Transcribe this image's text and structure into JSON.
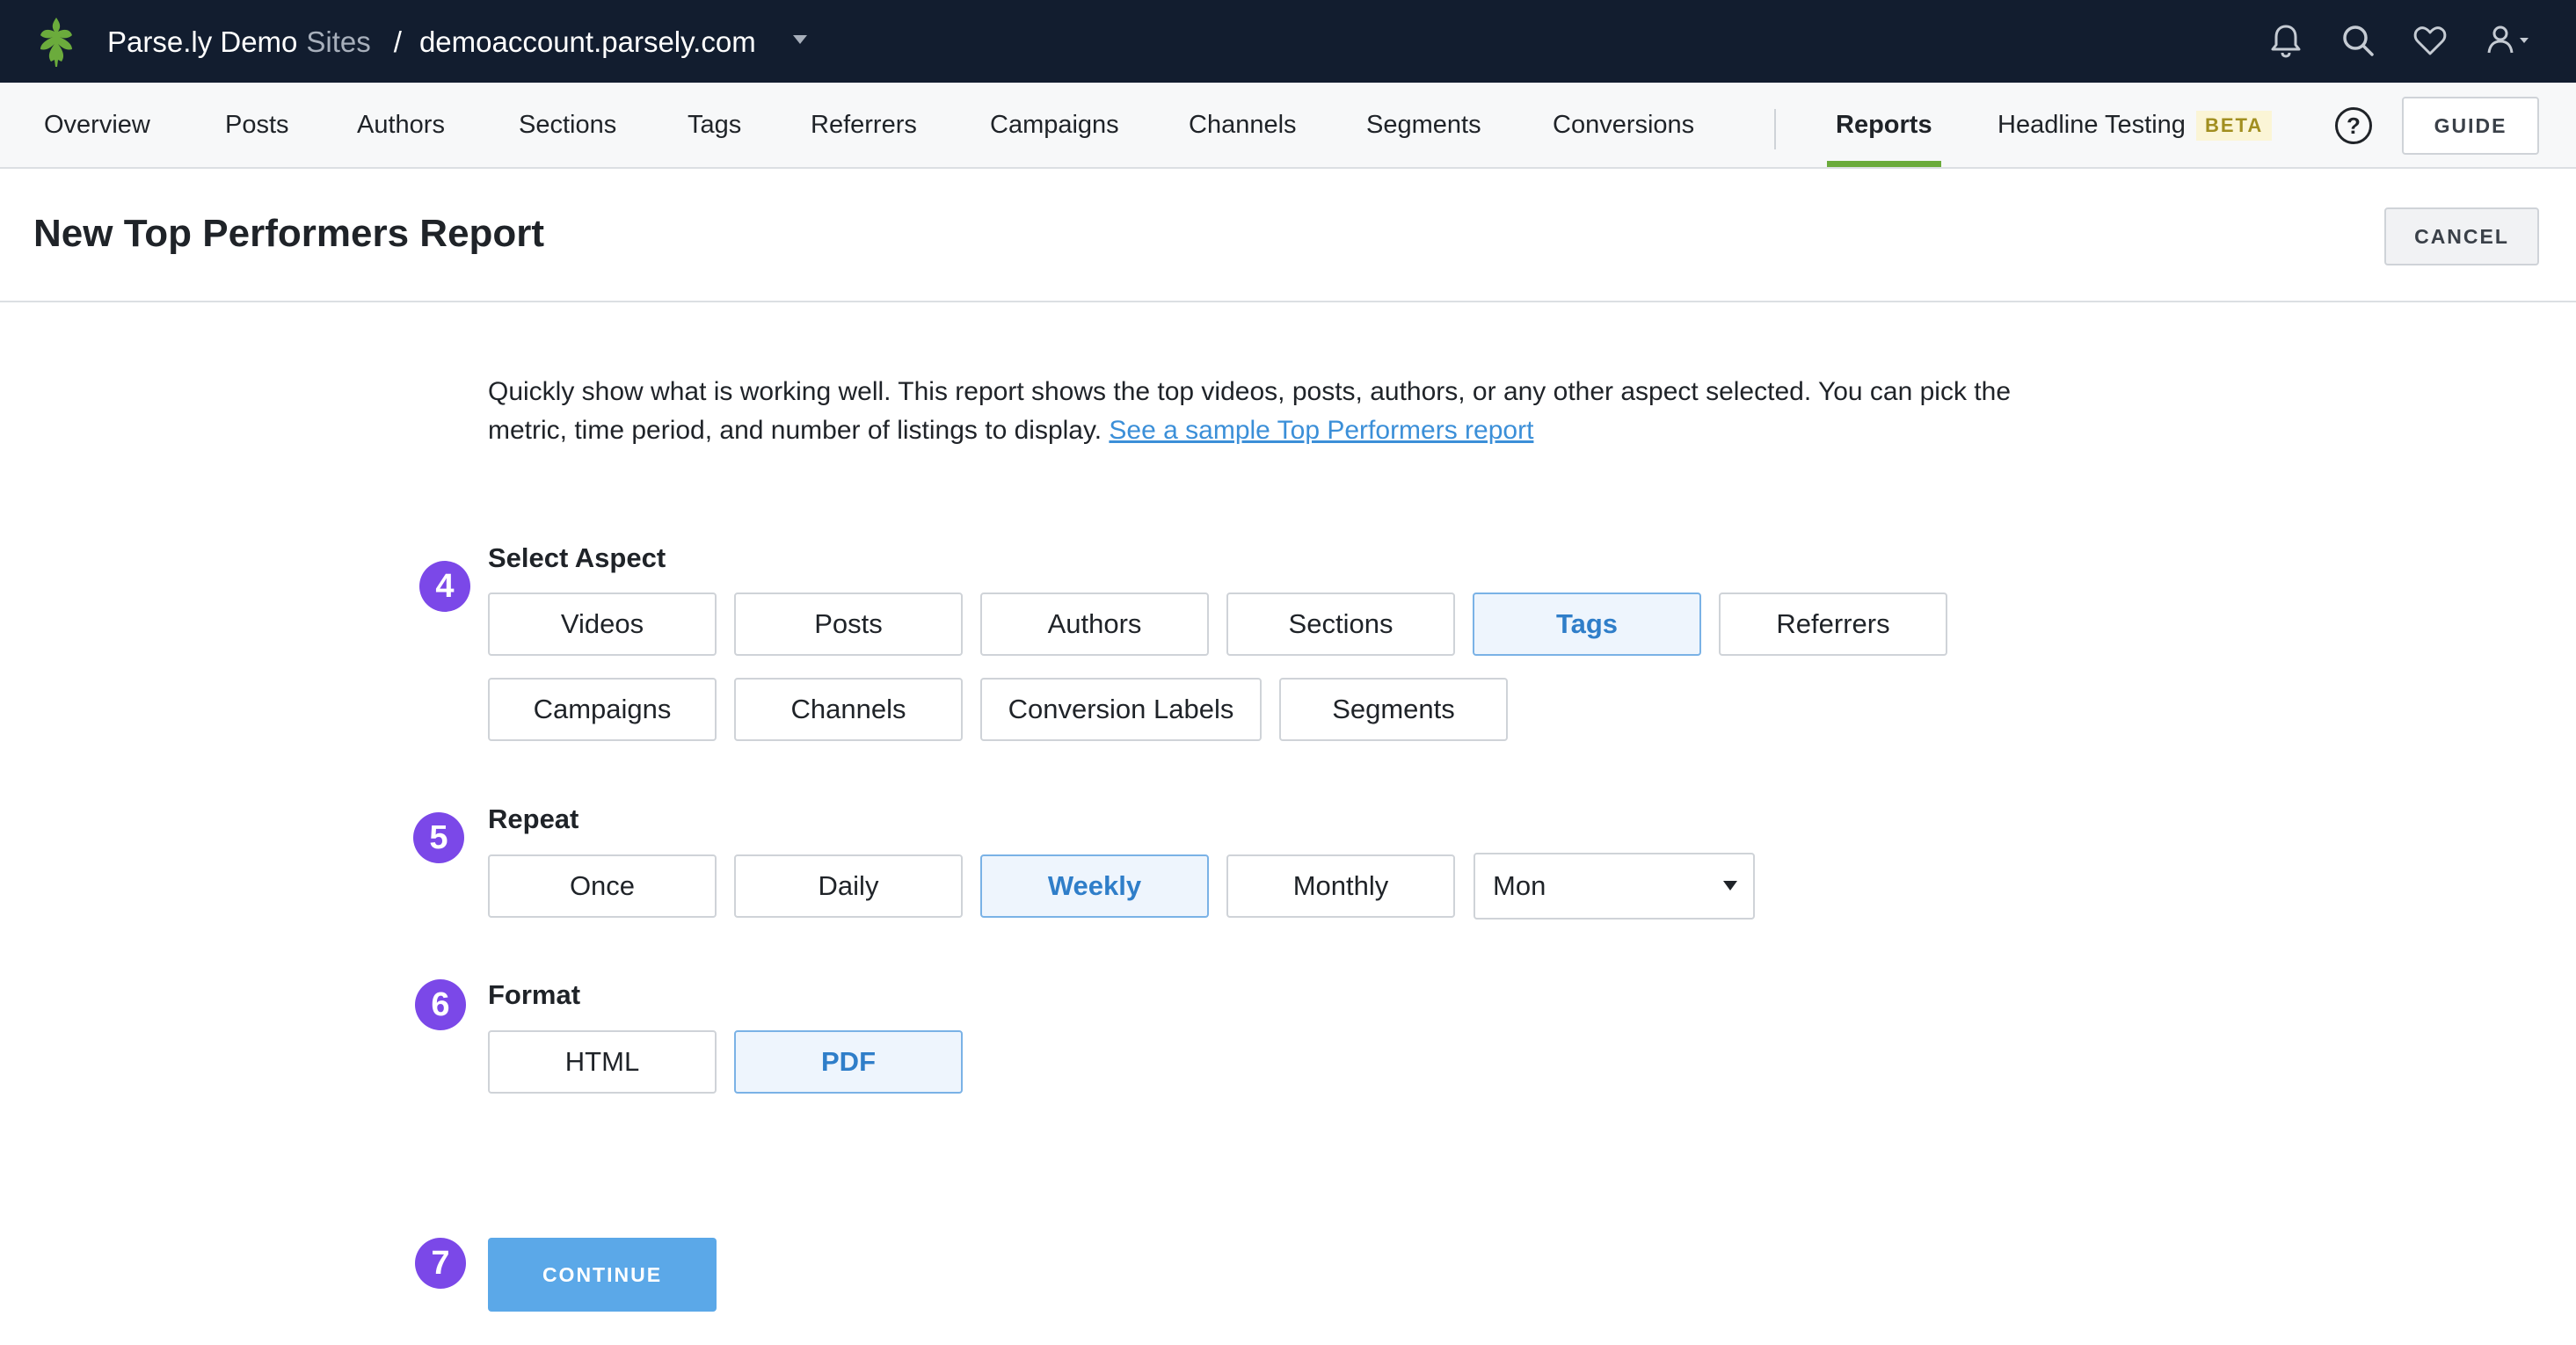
{
  "topbar": {
    "brand": "Parse.ly Demo",
    "sites_label": "Sites",
    "separator": "/",
    "domain": "demoaccount.parsely.com",
    "icons": [
      "bell-icon",
      "search-icon",
      "heart-icon",
      "user-icon"
    ]
  },
  "nav": {
    "items": [
      "Overview",
      "Posts",
      "Authors",
      "Sections",
      "Tags",
      "Referrers",
      "Campaigns",
      "Channels",
      "Segments",
      "Conversions"
    ],
    "reports": "Reports",
    "headline_testing": "Headline Testing",
    "beta": "BETA",
    "help": "?",
    "guide": "GUIDE"
  },
  "header": {
    "title": "New Top Performers Report",
    "cancel": "CANCEL"
  },
  "description": {
    "text": "Quickly show what is working well. This report shows the top videos, posts, authors, or any other aspect selected. You can pick the metric, time period, and number of listings to display. ",
    "link": "See a sample Top Performers report"
  },
  "aspect": {
    "step": "4",
    "label": "Select Aspect",
    "options": [
      "Videos",
      "Posts",
      "Authors",
      "Sections",
      "Tags",
      "Referrers",
      "Campaigns",
      "Channels",
      "Conversion Labels",
      "Segments"
    ],
    "selected": "Tags"
  },
  "repeat": {
    "step": "5",
    "label": "Repeat",
    "options": [
      "Once",
      "Daily",
      "Weekly",
      "Monthly"
    ],
    "selected": "Weekly",
    "day_value": "Mon"
  },
  "format": {
    "step": "6",
    "label": "Format",
    "options": [
      "HTML",
      "PDF"
    ],
    "selected": "PDF"
  },
  "continue": {
    "step": "7",
    "label": "CONTINUE"
  },
  "colors": {
    "topbar": "#121d2f",
    "accent_green": "#6bab3c",
    "step_purple": "#7b48e8",
    "selected_blue": "#2f7ec9",
    "continue_blue": "#5ba8e8",
    "link_blue": "#3b8fd8"
  }
}
